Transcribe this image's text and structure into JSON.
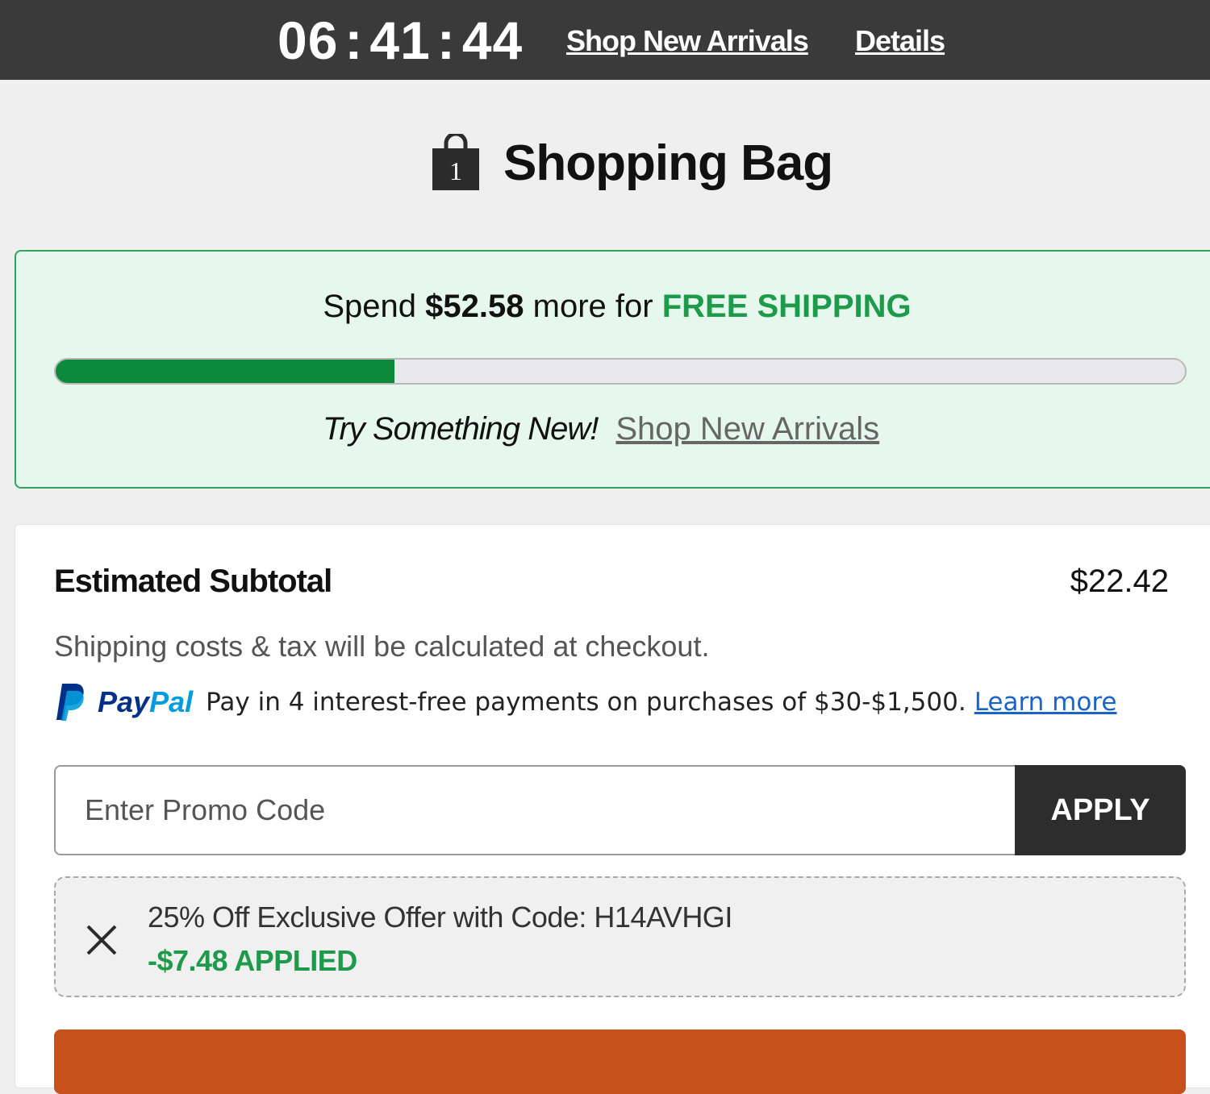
{
  "topbar": {
    "countdown": {
      "hours": "06",
      "minutes": "41",
      "seconds": "44",
      "separator": ":"
    },
    "shop_link": "Shop New Arrivals",
    "details_link": "Details"
  },
  "header": {
    "bag_count": "1",
    "title": "Shopping Bag"
  },
  "free_shipping": {
    "prefix": "Spend",
    "amount": "$52.58",
    "middle": "more for",
    "highlight": "FREE SHIPPING",
    "progress_fraction": 0.3,
    "try_text": "Try Something New!",
    "try_link": "Shop New Arrivals",
    "colors": {
      "accent": "#1d9a4a",
      "bar_fill": "#0c8a3c",
      "box_bg": "#e6f8ee"
    }
  },
  "summary": {
    "subtotal_label": "Estimated Subtotal",
    "subtotal_value": "$22.42",
    "shipping_note": "Shipping costs & tax will be calculated at checkout.",
    "paypal": {
      "icon": "paypal-p-icon",
      "brand_pay": "Pay",
      "brand_pal": "Pal",
      "text": "Pay in 4 interest-free payments on purchases of $30-$1,500.",
      "link": "Learn more"
    },
    "promo": {
      "placeholder": "Enter Promo Code",
      "value": "",
      "apply_label": "APPLY"
    },
    "applied_offer": {
      "remove_icon": "close-icon",
      "description": "25% Off Exclusive Offer with Code: H14AVHGI",
      "applied_text": "-$7.48 APPLIED"
    },
    "checkout_color": "#c8501b"
  }
}
